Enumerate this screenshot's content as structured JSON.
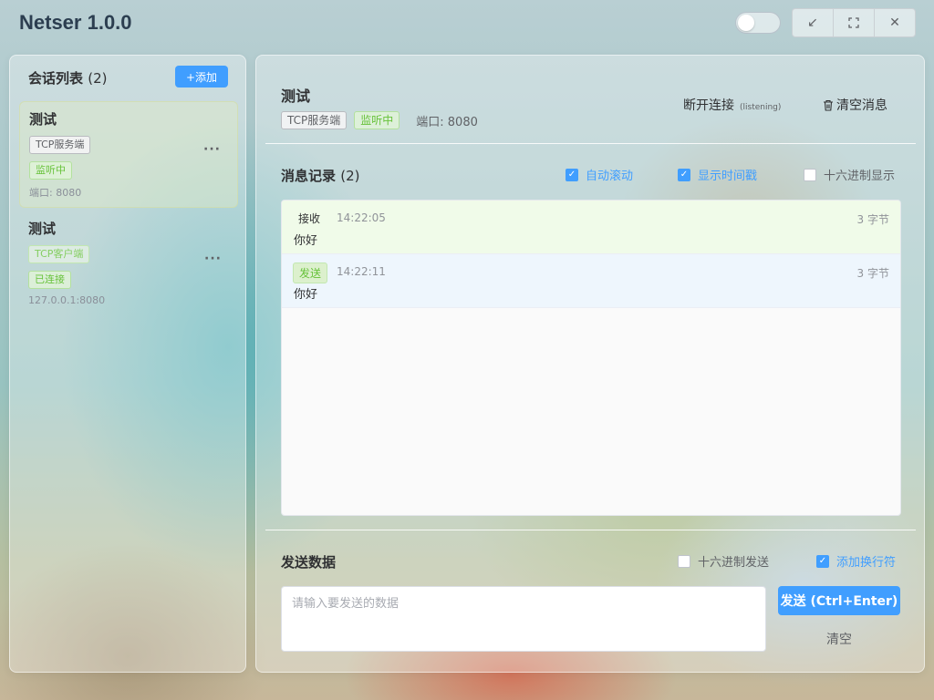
{
  "app": {
    "title": "Netser 1.0.0"
  },
  "window_controls": {
    "minimize_icon": "↙",
    "maximize_icon": "⛶",
    "close_icon": "✕"
  },
  "sidebar": {
    "title": "会话列表",
    "count": "(2)",
    "add_label": "+添加",
    "sessions": [
      {
        "name": "测试",
        "type": "TCP服务端",
        "status": "监听中",
        "address": "端口: 8080",
        "active": true
      },
      {
        "name": "测试",
        "type": "TCP客户端",
        "status": "已连接",
        "address": "127.0.0.1:8080",
        "active": false
      }
    ],
    "more_icon": "···"
  },
  "header": {
    "title": "测试",
    "type_tag": "TCP服务端",
    "status_tag": "监听中",
    "port_text": "端口: 8080",
    "disconnect_label": "断开连接",
    "disconnect_sub": "(listening)",
    "clear_messages_label": "清空消息",
    "trash_icon": "trash-icon"
  },
  "messages": {
    "title": "消息记录",
    "count": "(2)",
    "options": [
      {
        "label": "自动滚动",
        "checked": true
      },
      {
        "label": "显示时间戳",
        "checked": true
      },
      {
        "label": "十六进制显示",
        "checked": false
      }
    ],
    "items": [
      {
        "direction": "接收",
        "time": "14:22:05",
        "size": "3 字节",
        "content": "你好"
      },
      {
        "direction": "发送",
        "time": "14:22:11",
        "size": "3 字节",
        "content": "你好"
      }
    ]
  },
  "send": {
    "title": "发送数据",
    "hex_send_label": "十六进制发送",
    "hex_send_checked": false,
    "newline_label": "添加换行符",
    "newline_checked": true,
    "placeholder": "请输入要发送的数据",
    "send_label": "发送 (Ctrl+Enter)",
    "clear_label": "清空"
  },
  "colors": {
    "primary": "#409eff",
    "success": "#67c23a"
  }
}
